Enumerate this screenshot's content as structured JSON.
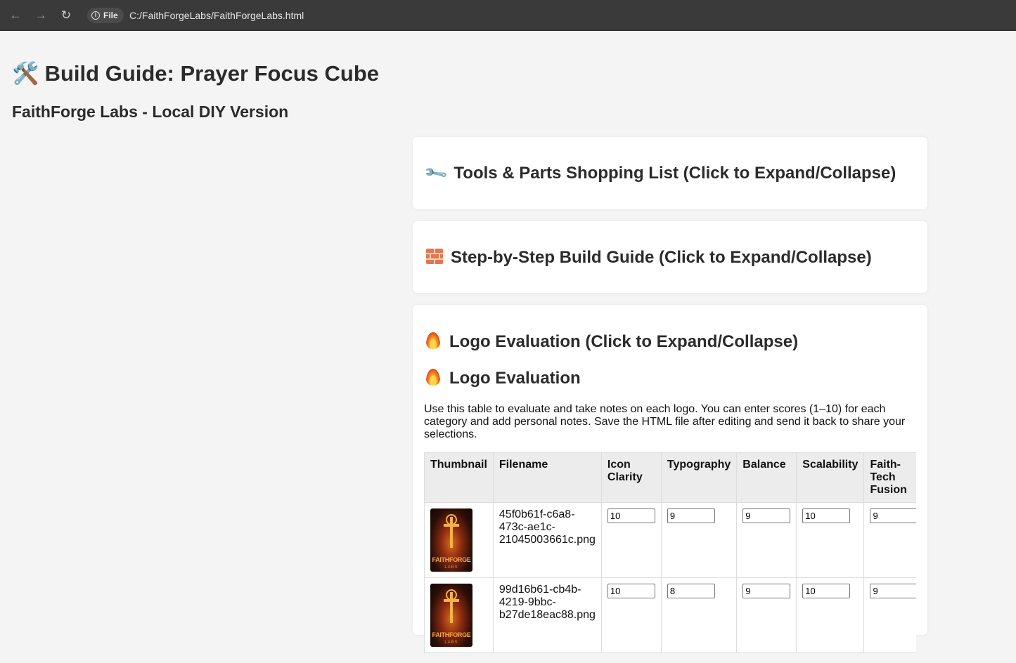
{
  "browser": {
    "scheme_label": "File",
    "url": "C:/FaithForgeLabs/FaithForgeLabs.html"
  },
  "page": {
    "title": "Build Guide: Prayer Focus Cube",
    "title_icon": "hammer-and-wrench-icon",
    "subtitle": "FaithForge Labs - Local DIY Version"
  },
  "sections": {
    "tools": {
      "title": "Tools & Parts Shopping List (Click to Expand/Collapse)",
      "icon": "wrench-icon"
    },
    "build": {
      "title": "Step-by-Step Build Guide (Click to Expand/Collapse)",
      "icon": "brick-icon"
    },
    "logo": {
      "title": "Logo Evaluation (Click to Expand/Collapse)",
      "icon": "fire-icon",
      "heading": "Logo Evaluation",
      "description": "Use this table to evaluate and take notes on each logo. You can enter scores (1–10) for each category and add personal notes. Save the HTML file after editing and send it back to share your selections.",
      "columns": [
        "Thumbnail",
        "Filename",
        "Icon Clarity",
        "Typography",
        "Balance",
        "Scalability",
        "Faith-Tech Fusion"
      ],
      "thumbnail_text": [
        "FAITHFORGE",
        "LABS"
      ],
      "rows": [
        {
          "filename": "45f0b61f-c6a8-473c-ae1c-21045003661c.png",
          "icon_clarity": "10",
          "typography": "9",
          "balance": "9",
          "scalability": "10",
          "faith_tech_fusion": "9"
        },
        {
          "filename": "99d16b61-cb4b-4219-9bbc-b27de18eac88.png",
          "icon_clarity": "10",
          "typography": "8",
          "balance": "9",
          "scalability": "10",
          "faith_tech_fusion": "9"
        }
      ]
    }
  }
}
